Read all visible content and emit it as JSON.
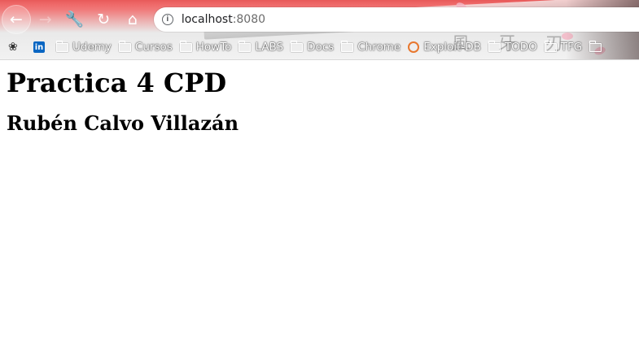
{
  "browser": {
    "address_bar": {
      "host": "localhost",
      "port": ":8080"
    },
    "icons": {
      "back": "back-arrow-icon",
      "forward": "forward-arrow-icon",
      "extensions": "wrench-icon",
      "reload": "reload-icon",
      "home": "home-icon",
      "site_info": "info-icon"
    },
    "bookmarks": [
      {
        "label": "",
        "icon": "app-icon"
      },
      {
        "label": "",
        "icon": "linkedin-icon"
      },
      {
        "label": "Udemy",
        "icon": "folder-icon"
      },
      {
        "label": "Cursos",
        "icon": "folder-icon"
      },
      {
        "label": "HowTo",
        "icon": "folder-icon"
      },
      {
        "label": "LABS",
        "icon": "folder-icon"
      },
      {
        "label": "Docs",
        "icon": "folder-icon"
      },
      {
        "label": "Chrome",
        "icon": "folder-icon"
      },
      {
        "label": "Exploit-DB",
        "icon": "exploit-db-icon"
      },
      {
        "label": "TODO",
        "icon": "folder-icon"
      },
      {
        "label": "TFG",
        "icon": "folder-icon"
      },
      {
        "label": "",
        "icon": "folder-icon"
      }
    ],
    "colors": {
      "theme_red": "#e85a5a",
      "page_bg": "#ffffff"
    }
  },
  "page": {
    "title": "Practica 4 CPD",
    "subtitle": "Rubén Calvo Villazán"
  }
}
